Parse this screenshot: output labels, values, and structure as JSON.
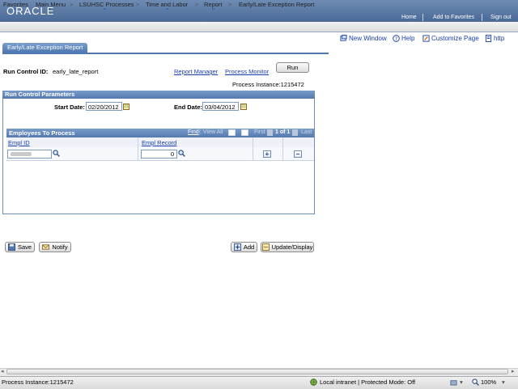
{
  "header": {
    "logo": "ORACLE",
    "links": [
      "Home",
      "Add to Favorites",
      "Sign out"
    ]
  },
  "menu": {
    "items": [
      "Favorites",
      "Main Menu",
      "LSUHSC Processes",
      "Time and Labor",
      "Report",
      "Early/Late Exception Report"
    ],
    "separator": ">"
  },
  "toolbar": {
    "new_window": "New Window",
    "help": "Help",
    "customize": "Customize Page",
    "http": "http"
  },
  "tab": {
    "label": "Early/Late Exception Report"
  },
  "run_control": {
    "id_label": "Run Control ID:",
    "id_value": "early_late_report",
    "report_manager": "Report Manager",
    "process_monitor": "Process Monitor",
    "run_label": "Run",
    "process_instance": "Process Instance:1215472"
  },
  "params": {
    "title": "Run Control Parameters",
    "start_label": "Start Date:",
    "start_value": "02/20/2012",
    "end_label": "End Date:",
    "end_value": "03/04/2012"
  },
  "grid": {
    "title": "Employees To Process",
    "find": "Find",
    "view_all": "View All",
    "first": "First",
    "page": "1 of 1",
    "last": "Last",
    "col_empl_id": "Empl ID",
    "col_empl_record": "Empl Record",
    "empl_record_value": "0"
  },
  "buttons": {
    "save": "Save",
    "notify": "Notify",
    "add": "Add",
    "update": "Update/Display"
  },
  "status": {
    "left": "Process Instance:1215472",
    "zone": "Local intranet | Protected Mode: Off",
    "zoom": "100%"
  },
  "colors": {
    "header": "#4a6996",
    "link": "#1a3ca8",
    "accent": "#5479ae"
  }
}
